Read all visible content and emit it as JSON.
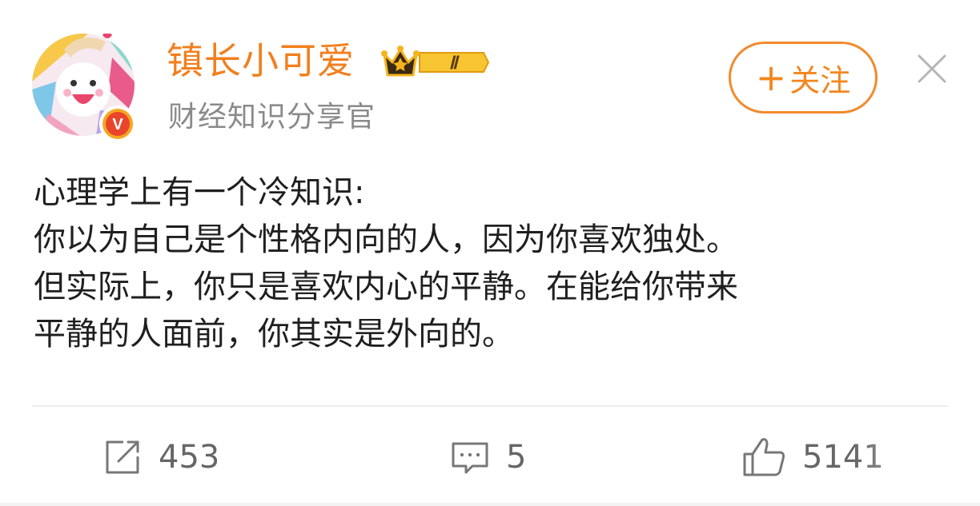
{
  "user": {
    "name": "镇长小可爱",
    "title": "财经知识分享官",
    "level_badge": "Ⅱ",
    "verified_mark": "V"
  },
  "follow": {
    "plus": "+",
    "label": "关注"
  },
  "post": {
    "lines": [
      "心理学上有一个冷知识:",
      "你以为自己是个性格内向的人，因为你喜欢独处。",
      "但实际上，你只是喜欢内心的平静。在能给你带来",
      "平静的人面前，你其实是外向的。"
    ]
  },
  "actions": {
    "repost": {
      "icon": "repost-icon",
      "count": "453"
    },
    "comment": {
      "icon": "comment-icon",
      "count": "5"
    },
    "like": {
      "icon": "thumbs-up-icon",
      "count": "5141"
    }
  },
  "colors": {
    "accent": "#F27F1D",
    "secondary_text": "#8A8A8A",
    "body_text": "#1F1F1F",
    "icon": "#666666",
    "badge_gold": "#F5B41E"
  }
}
